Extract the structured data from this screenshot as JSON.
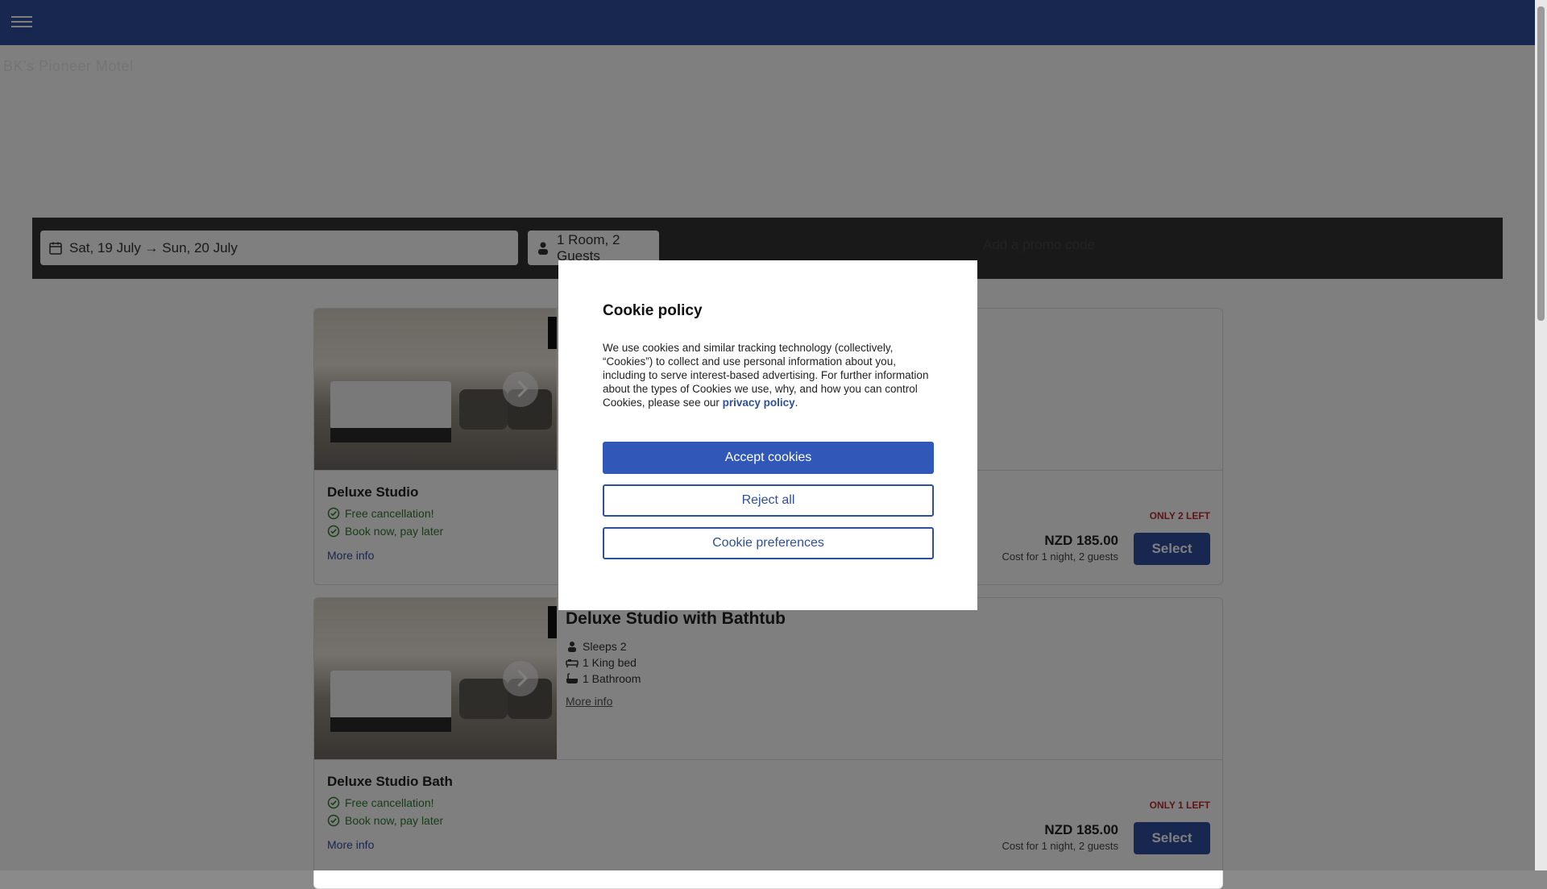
{
  "header": {
    "menu_icon": "hamburger-icon",
    "brand": "BK's Pioneer Motel"
  },
  "search": {
    "dates": "Sat, 19 July → Sun, 20 July",
    "guests": "1 Room, 2 Guests",
    "promo": "Add a promo code"
  },
  "rooms": [
    {
      "title": "",
      "rate_name": "Deluxe Studio",
      "perks": [
        "Free cancellation!",
        "Book now, pay later"
      ],
      "more_info": "More info",
      "availability": "ONLY 2 LEFT",
      "price": "NZD 185.00",
      "cost_note": "Cost for 1 night, 2 guests",
      "select_label": "Select"
    },
    {
      "title": "Deluxe Studio with Bathtub",
      "features": [
        "Sleeps 2",
        "1 King bed",
        "1 Bathroom"
      ],
      "room_more_info": "More info",
      "rate_name": "Deluxe Studio Bath",
      "perks": [
        "Free cancellation!",
        "Book now, pay later"
      ],
      "more_info": "More info",
      "availability": "ONLY 1 LEFT",
      "price": "NZD 185.00",
      "cost_note": "Cost for 1 night, 2 guests",
      "select_label": "Select"
    }
  ],
  "cookie_modal": {
    "title": "Cookie policy",
    "body": "We use cookies and similar tracking technology (collectively, “Cookies”) to collect and use personal information about you, including to serve interest-based advertising. For further information about the types of Cookies we use, why, and how you can control Cookies, please see our ",
    "link": "privacy policy",
    "body_end": ".",
    "accept": "Accept cookies",
    "reject": "Reject all",
    "preferences": "Cookie preferences"
  },
  "colors": {
    "brand_blue": "#2e4f9e",
    "alert_red": "#c0282d",
    "success_green": "#2f7a2f"
  }
}
